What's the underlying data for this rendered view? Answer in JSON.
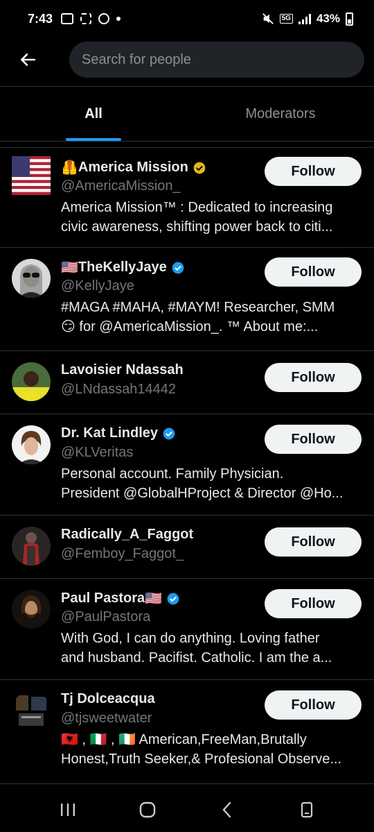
{
  "status_bar": {
    "time": "7:43",
    "network": "5G",
    "battery": "43%"
  },
  "header": {
    "search_placeholder": "Search for people"
  },
  "tabs": [
    {
      "label": "All",
      "active": true
    },
    {
      "label": "Moderators",
      "active": false
    }
  ],
  "accent_color": "#1d9bf0",
  "users": [
    {
      "prefix_emoji": "🦺",
      "name": "America Mission",
      "suffix_emoji": "",
      "verified": "gold",
      "handle": "@AmericaMission_",
      "bio": [
        "America Mission™ : Dedicated to increasing",
        "civic awareness, shifting power back to citi..."
      ],
      "follow_label": "Follow",
      "avatar": "us-flag"
    },
    {
      "prefix_emoji": "🇺🇸",
      "name": "TheKellyJaye",
      "suffix_emoji": "",
      "verified": "blue",
      "handle": "@KellyJaye",
      "bio": [
        "#MAGA #MAHA, #MAYM! Researcher, SMM",
        "😏 for @AmericaMission_. ™  About me:..."
      ],
      "follow_label": "Follow",
      "avatar": "woman-sunglasses"
    },
    {
      "prefix_emoji": "",
      "name": "Lavoisier Ndassah",
      "suffix_emoji": "",
      "verified": "",
      "handle": "@LNdassah14442",
      "bio": [],
      "follow_label": "Follow",
      "avatar": "man-yellow-shirt"
    },
    {
      "prefix_emoji": "",
      "name": "Dr. Kat Lindley",
      "suffix_emoji": "",
      "verified": "blue",
      "handle": "@KLVeritas",
      "bio": [
        "Personal account. Family Physician.",
        "President @GlobalHProject & Director @Ho..."
      ],
      "follow_label": "Follow",
      "avatar": "woman-portrait"
    },
    {
      "prefix_emoji": "",
      "name": "Radically_A_Faggot",
      "suffix_emoji": "",
      "verified": "",
      "handle": "@Femboy_Faggot_",
      "bio": [],
      "follow_label": "Follow",
      "avatar": "red-figure"
    },
    {
      "prefix_emoji": "",
      "name": "Paul Pastora",
      "suffix_emoji": "🇺🇸",
      "verified": "blue",
      "handle": "@PaulPastora",
      "bio": [
        "With God, I can do anything. Loving father",
        "and husband. Pacifist. Catholic. I am the a..."
      ],
      "follow_label": "Follow",
      "avatar": "bearded-man"
    },
    {
      "prefix_emoji": "",
      "name": "Tj Dolceacqua",
      "suffix_emoji": "",
      "verified": "",
      "handle": "@tjsweetwater",
      "bio": [
        "🇦🇱 , 🇮🇹 , 🇮🇪  American,FreeMan,Brutally",
        "Honest,Truth Seeker,& Profesional Observe..."
      ],
      "follow_label": "Follow",
      "avatar": "collage"
    }
  ]
}
